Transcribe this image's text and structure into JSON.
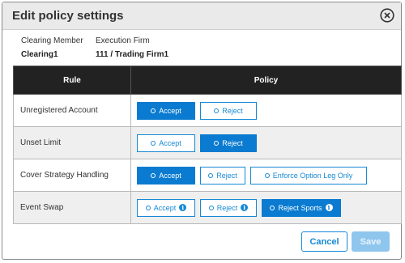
{
  "dialog": {
    "title": "Edit policy settings",
    "close_icon": "close-circle-icon"
  },
  "info": {
    "clearing_member_label": "Clearing Member",
    "clearing_member_value": "Clearing1",
    "execution_firm_label": "Execution Firm",
    "execution_firm_value": "111 / Trading Firm1"
  },
  "table": {
    "headers": [
      "Rule",
      "Policy"
    ],
    "rows": [
      {
        "rule": "Unregistered Account",
        "options": [
          {
            "label": "Accept",
            "selected": true,
            "info": false
          },
          {
            "label": "Reject",
            "selected": false,
            "info": false
          }
        ]
      },
      {
        "rule": "Unset Limit",
        "options": [
          {
            "label": "Accept",
            "selected": false,
            "info": false
          },
          {
            "label": "Reject",
            "selected": true,
            "info": false
          }
        ]
      },
      {
        "rule": "Cover Strategy Handling",
        "options": [
          {
            "label": "Accept",
            "selected": true,
            "info": false
          },
          {
            "label": "Reject",
            "selected": false,
            "info": false
          },
          {
            "label": "Enforce Option Leg Only",
            "selected": false,
            "info": false
          }
        ]
      },
      {
        "rule": "Event Swap",
        "options": [
          {
            "label": "Accept",
            "selected": false,
            "info": true
          },
          {
            "label": "Reject",
            "selected": false,
            "info": true
          },
          {
            "label": "Reject Sports",
            "selected": true,
            "info": true
          }
        ]
      }
    ]
  },
  "footer": {
    "cancel_label": "Cancel",
    "save_label": "Save"
  },
  "colors": {
    "accent": "#0a7bd0",
    "header_bg": "#222222",
    "save_disabled": "#8fc6ee"
  }
}
